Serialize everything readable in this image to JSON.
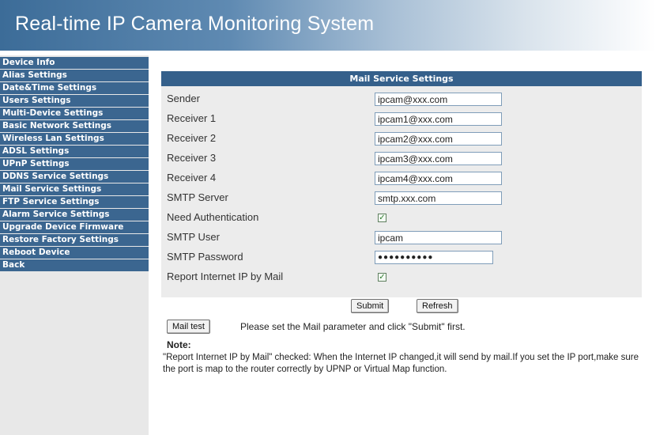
{
  "header": {
    "title": "Real-time IP Camera Monitoring System"
  },
  "sidebar": {
    "items": [
      {
        "label": "Device Info"
      },
      {
        "label": "Alias Settings"
      },
      {
        "label": "Date&Time Settings"
      },
      {
        "label": "Users Settings"
      },
      {
        "label": "Multi-Device Settings"
      },
      {
        "label": "Basic Network Settings"
      },
      {
        "label": "Wireless Lan Settings"
      },
      {
        "label": "ADSL Settings"
      },
      {
        "label": "UPnP Settings"
      },
      {
        "label": "DDNS Service Settings"
      },
      {
        "label": "Mail Service Settings"
      },
      {
        "label": "FTP Service Settings"
      },
      {
        "label": "Alarm Service Settings"
      },
      {
        "label": "Upgrade Device Firmware"
      },
      {
        "label": "Restore Factory Settings"
      },
      {
        "label": "Reboot Device"
      },
      {
        "label": "Back"
      }
    ]
  },
  "form": {
    "section_title": "Mail Service Settings",
    "sender": {
      "label": "Sender",
      "value": "ipcam@xxx.com"
    },
    "receiver1": {
      "label": "Receiver 1",
      "value": "ipcam1@xxx.com"
    },
    "receiver2": {
      "label": "Receiver 2",
      "value": "ipcam2@xxx.com"
    },
    "receiver3": {
      "label": "Receiver 3",
      "value": "ipcam3@xxx.com"
    },
    "receiver4": {
      "label": "Receiver 4",
      "value": "ipcam4@xxx.com"
    },
    "smtp_server": {
      "label": "SMTP Server",
      "value": "smtp.xxx.com"
    },
    "need_auth": {
      "label": "Need Authentication",
      "checked": true
    },
    "smtp_user": {
      "label": "SMTP User",
      "value": "ipcam"
    },
    "smtp_password": {
      "label": "SMTP Password",
      "value": "●●●●●●●●●●"
    },
    "report_ip": {
      "label": "Report Internet IP by Mail",
      "checked": true
    },
    "submit_label": "Submit",
    "refresh_label": "Refresh"
  },
  "mail_test": {
    "button_label": "Mail test",
    "hint": "Please set the Mail parameter and click \"Submit\" first."
  },
  "note": {
    "label": "Note:",
    "text": "\"Report Internet IP by Mail\" checked: When the Internet IP changed,it will send by mail.If you set the IP port,make sure the port is map to the router correctly by UPNP or Virtual Map function."
  },
  "checkbox_mark": "✓"
}
